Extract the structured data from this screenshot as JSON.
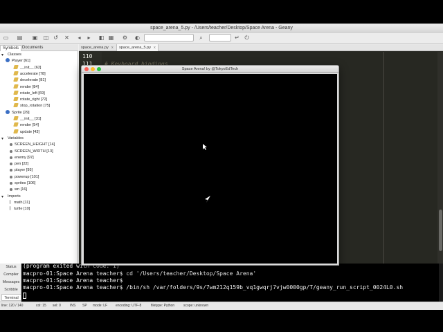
{
  "window": {
    "title": "space_arena_5.py - /Users/teacher/Desktop/Space Arena - Geany"
  },
  "sidebar": {
    "tabs": [
      "Symbols",
      "Documents"
    ],
    "tree": [
      {
        "text": "Classes",
        "kind": "fold-open"
      },
      {
        "text": "Player [61]",
        "kind": "class"
      },
      {
        "text": "__init__ [62]",
        "kind": "method"
      },
      {
        "text": "accelerate [78]",
        "kind": "method"
      },
      {
        "text": "decelerate [81]",
        "kind": "method"
      },
      {
        "text": "render [84]",
        "kind": "method"
      },
      {
        "text": "rotate_left [69]",
        "kind": "method"
      },
      {
        "text": "rotate_right [72]",
        "kind": "method"
      },
      {
        "text": "stop_rotation [75]",
        "kind": "method"
      },
      {
        "text": "Sprite [29]",
        "kind": "class"
      },
      {
        "text": "__init__ [31]",
        "kind": "method"
      },
      {
        "text": "render [54]",
        "kind": "method"
      },
      {
        "text": "update [43]",
        "kind": "method"
      },
      {
        "text": "Variables",
        "kind": "fold-open"
      },
      {
        "text": "SCREEN_HEIGHT [14]",
        "kind": "var"
      },
      {
        "text": "SCREEN_WIDTH [13]",
        "kind": "var"
      },
      {
        "text": "enemy [97]",
        "kind": "var"
      },
      {
        "text": "pen [22]",
        "kind": "var"
      },
      {
        "text": "player [95]",
        "kind": "var"
      },
      {
        "text": "powerup [101]",
        "kind": "var"
      },
      {
        "text": "sprites [106]",
        "kind": "var"
      },
      {
        "text": "wn [16]",
        "kind": "var"
      },
      {
        "text": "Imports",
        "kind": "fold-open"
      },
      {
        "text": "math [11]",
        "kind": "import"
      },
      {
        "text": "turtle [10]",
        "kind": "import"
      }
    ]
  },
  "editor": {
    "tabs": [
      {
        "label": "space_arena.py",
        "close": "x"
      },
      {
        "label": "space_arena_5.py",
        "close": "x"
      }
    ],
    "lines": [
      {
        "num": "110",
        "code": ""
      },
      {
        "num": "111",
        "code": "# Keyboard bindings"
      }
    ]
  },
  "turtle_window": {
    "title": "Space Arena! by @TokyoEdTech"
  },
  "message_panel": {
    "tabs": [
      "Status",
      "Compiler",
      "Messages",
      "Scribble",
      "Terminal"
    ],
    "active_tab": "Terminal",
    "terminal_lines": [
      "(program exited with code: 1)",
      "macpro-01:Space Arena teacher$ cd '/Users/teacher/Desktop/Space Arena'",
      "macpro-01:Space Arena teacher$",
      "macpro-01:Space Arena teacher$ /bin/sh /var/folders/9s/7wm212q159b_vq1gwqrj7vjw0000gp/T/geany_run_script_0024L0.sh"
    ]
  },
  "statusbar": {
    "line": "line: 120 / 140",
    "col": "col: 15",
    "sel": "sel: 0",
    "ins": "INS",
    "sp": "SP",
    "mode": "mode: LF",
    "encoding": "encoding: UTF-8",
    "filetype": "filetype: Python",
    "scope": "scope: unknown"
  },
  "colors": {
    "editor_bg": "#272822",
    "comment": "#75715e",
    "traffic_close": "#fc5f57",
    "traffic_min": "#fdbc2e",
    "traffic_max": "#28c840"
  },
  "icons": [
    "new-file-icon",
    "open-file-icon",
    "save-icon",
    "save-all-icon",
    "revert-icon",
    "close-icon",
    "back-icon",
    "forward-icon",
    "compile-icon",
    "build-icon",
    "run-icon",
    "color-picker-icon",
    "find-icon",
    "jump-icon",
    "mouse-pointer-icon",
    "ship-icon"
  ]
}
